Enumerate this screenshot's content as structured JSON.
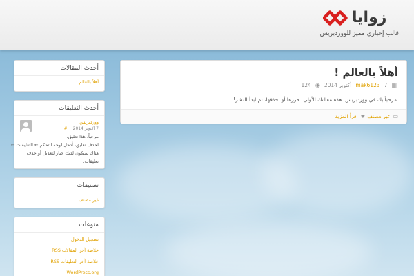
{
  "header": {
    "logo_text": "زوايا",
    "tagline": "قالب إخباري مميز للووردبريس"
  },
  "colors": {
    "accent": "#e0a100",
    "logo_red": "#d9201f"
  },
  "post": {
    "title": "أهلاً بالعالم !",
    "meta": {
      "comments": "7",
      "author": "mak6123",
      "date": "أكتوبر 2014",
      "views": "124"
    },
    "content": "مرحباً بك في ووردبريس. هذه مقالتك الأولى. حررها أو احذفها، ثم ابدأ النشر!",
    "category": "غير مصنف",
    "read_more": "اقرأ المزيد"
  },
  "sidebar": {
    "recent_posts": {
      "title": "أحدث المقالات",
      "items": [
        "أهلاً بالعالم !"
      ]
    },
    "recent_comments": {
      "title": "أحدث التعليقات",
      "author": "ووردبريس",
      "date": "7 أكتوبر 2014",
      "link": "#",
      "lines": [
        "مرحباً، هذا تعليق.",
        "لحذف تعليق، أدخل لوحة التحكم ← التعليقات ←",
        "هناك سيكون لديك خيار لتعديل أو حذف",
        "تعليقات."
      ]
    },
    "categories": {
      "title": "تصنيفات",
      "items": [
        "غير مصنف"
      ]
    },
    "meta": {
      "title": "منوعات",
      "items": [
        "تسجيل الدخول",
        "خلاصة آخر المقالات RSS",
        "خلاصة آخر التعليقات RSS",
        "WordPress.org"
      ]
    }
  }
}
